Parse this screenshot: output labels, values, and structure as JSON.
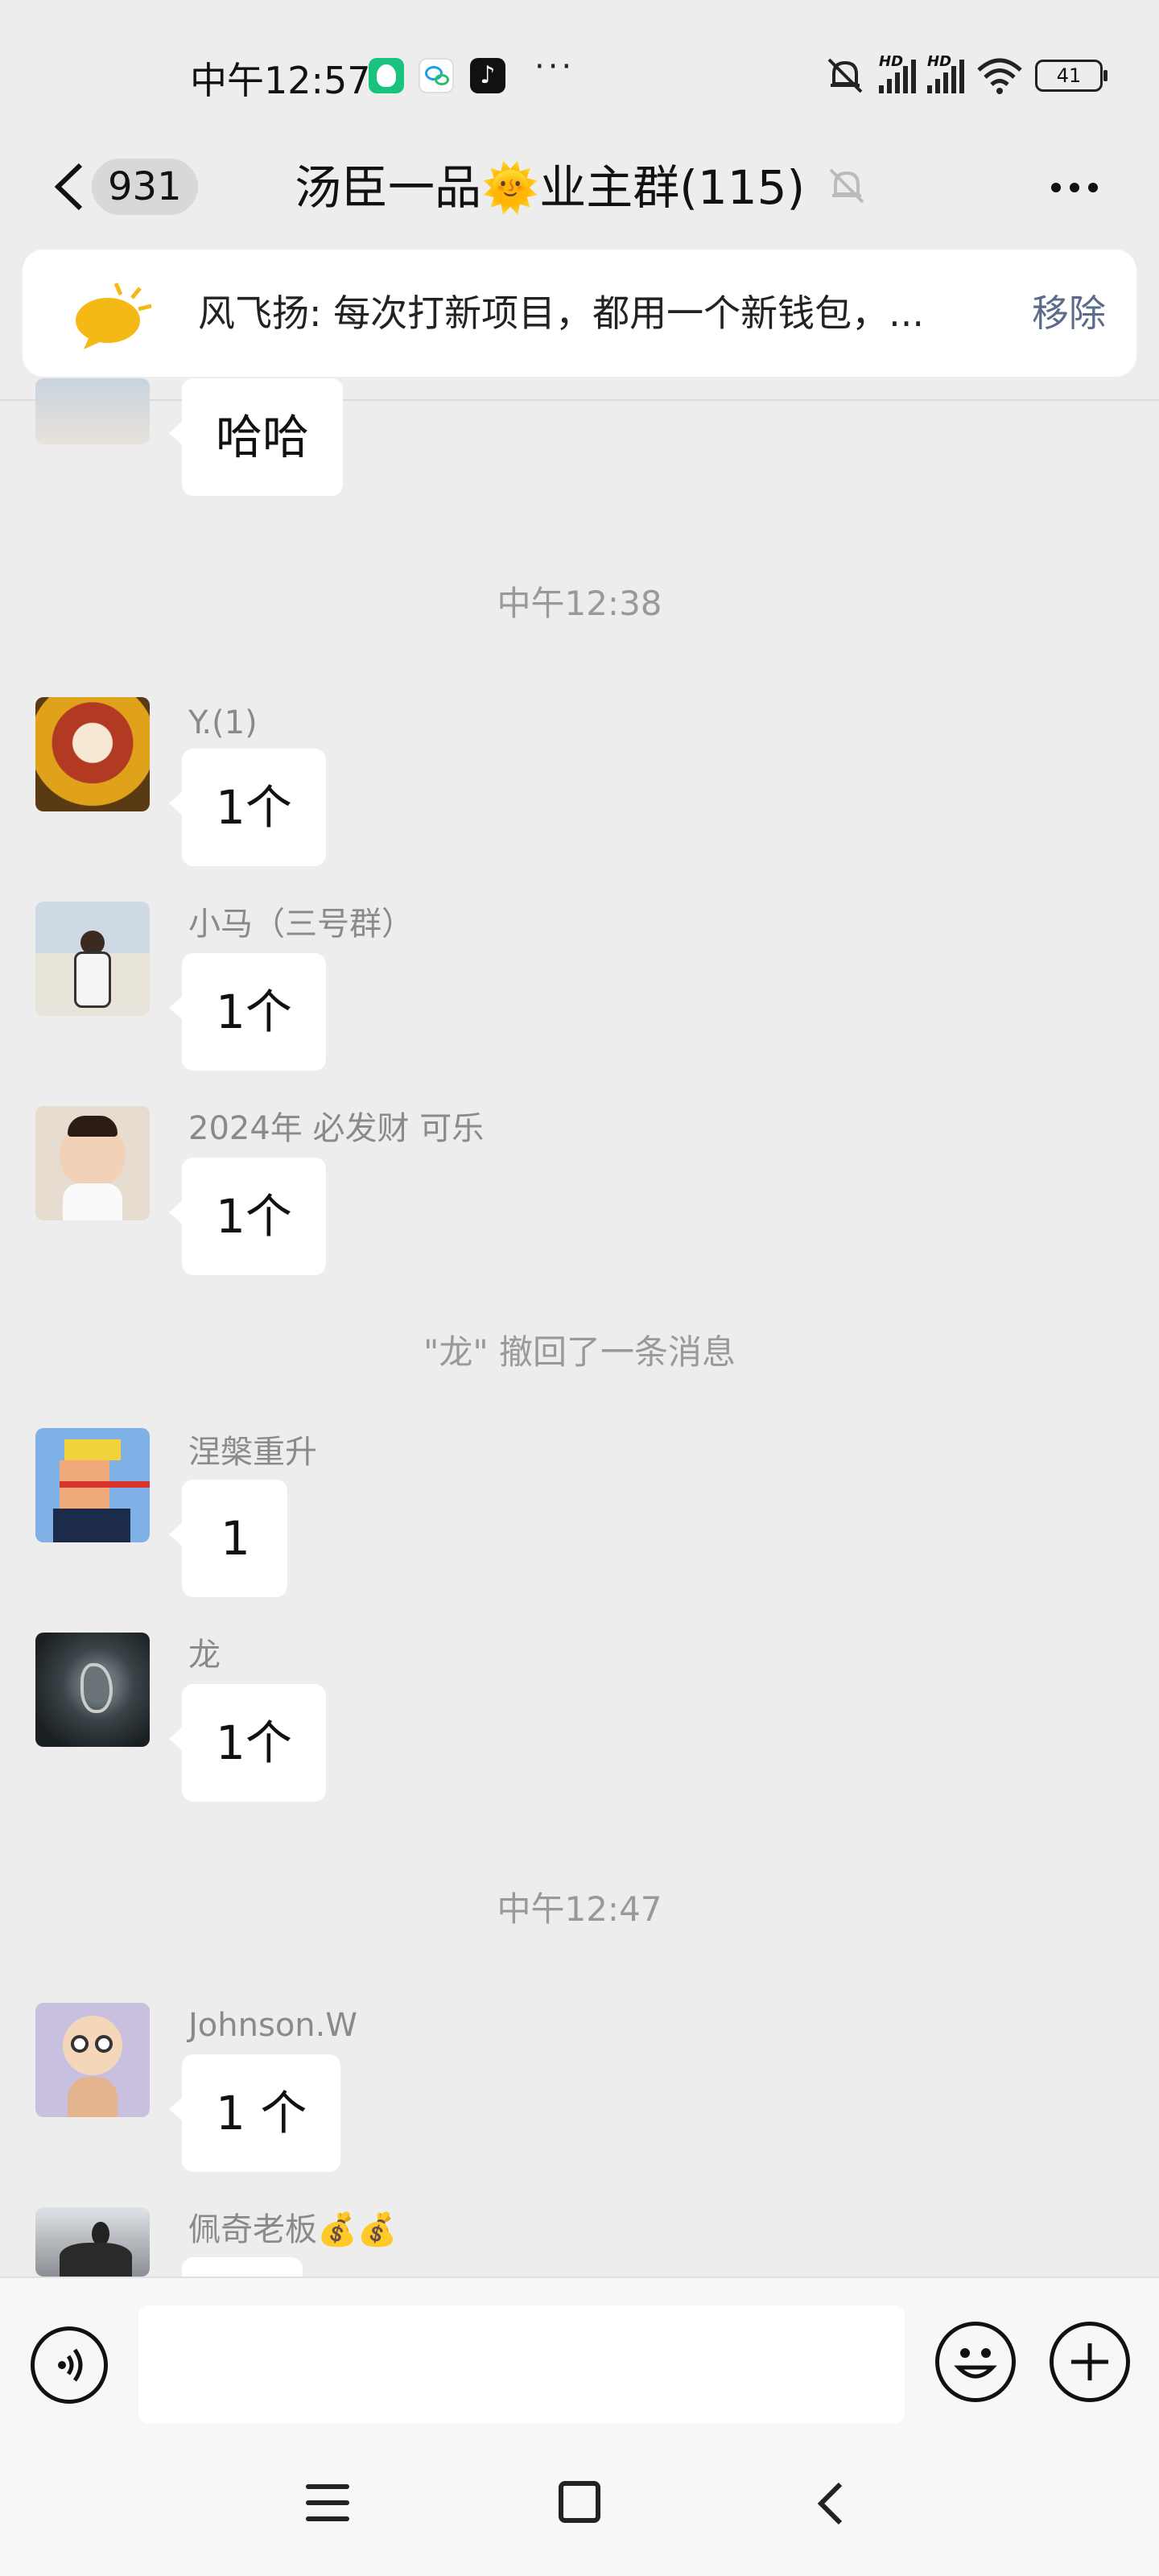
{
  "status_bar": {
    "time": "中午12:57",
    "tiktok_glyph": "♪",
    "more": "···",
    "battery": "41",
    "hd": "HD",
    "icons": [
      "app-shield-icon",
      "chat-bubbles-icon",
      "tiktok-icon",
      "muted-bell-icon",
      "signal-icon",
      "wifi-icon",
      "battery-icon"
    ]
  },
  "header": {
    "unread_count": "931",
    "title": "汤臣一品🌞业主群(115)"
  },
  "pinned": {
    "text": "风飞扬: 每次打新项目，都用一个新钱包，...",
    "remove": "移除"
  },
  "messages": {
    "first_bubble": "哈哈",
    "time1": "中午12:38",
    "msg1_sender": "Y.(1)",
    "msg1_text": "1个",
    "msg2_sender": "小马（三号群）",
    "msg2_text": "1个",
    "msg3_sender": "2024年 必发财 可乐",
    "msg3_text": "1个",
    "recall": "\"龙\" 撤回了一条消息",
    "msg4_sender": "涅槃重升",
    "msg4_text": "1",
    "msg5_sender": "龙",
    "msg5_text": "1个",
    "time2": "中午12:47",
    "msg6_sender": "Johnson.W",
    "msg6_text": "1 个",
    "msg7_sender": "佩奇老板💰💰"
  },
  "colors": {
    "background": "#ededed",
    "bubble": "#ffffff",
    "link": "#5b6b8c",
    "meta_text": "#999999"
  }
}
